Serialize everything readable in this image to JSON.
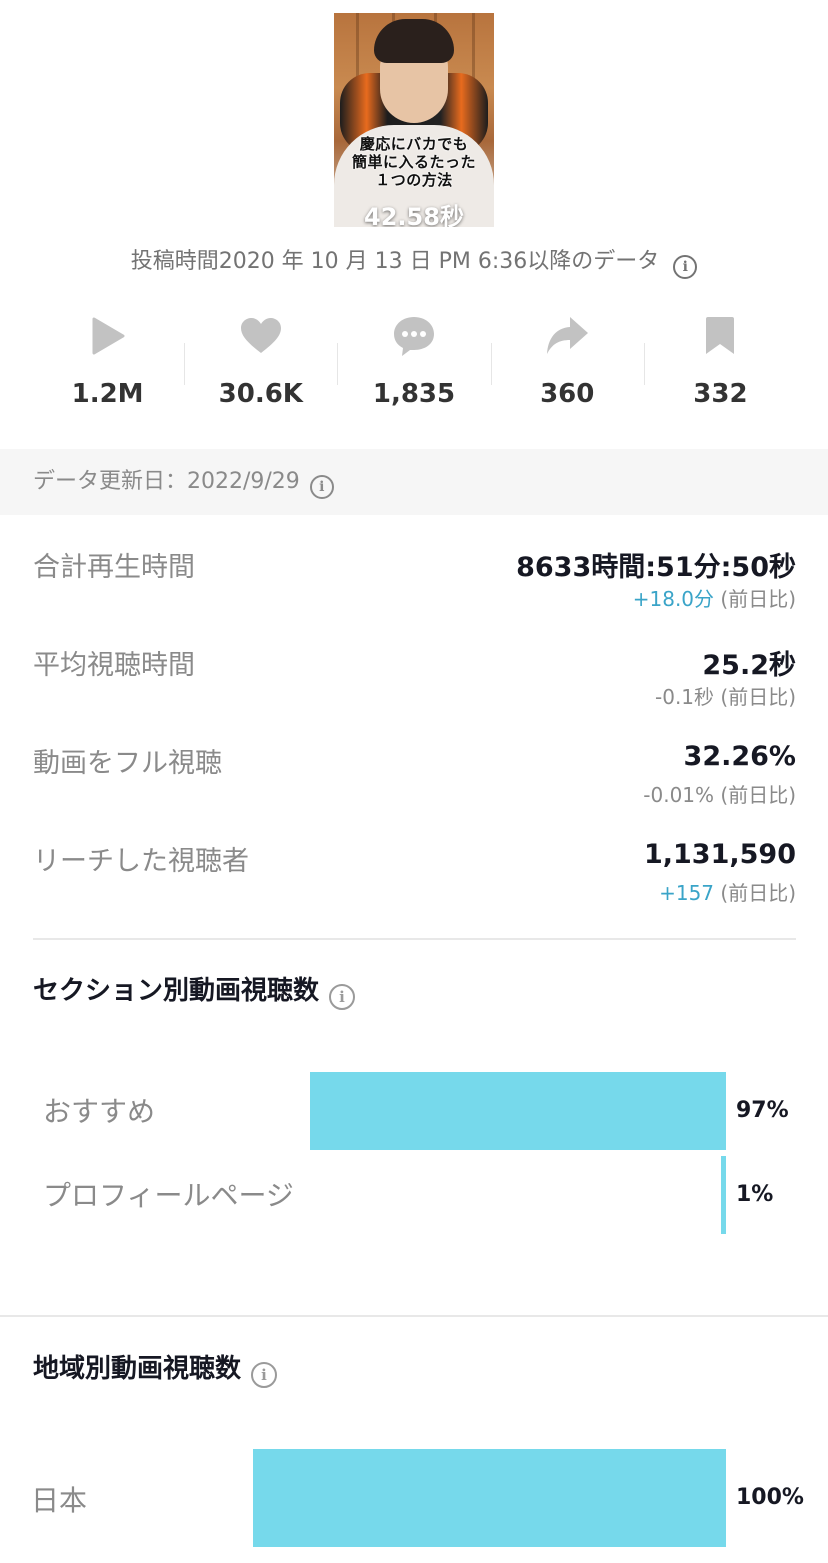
{
  "thumbnail": {
    "caption_lines": [
      "慶応にバカでも",
      "簡単に入るたった",
      "１つの方法"
    ],
    "duration": "42.58秒"
  },
  "posted_note": "投稿時間2020 年 10 月 13 日 PM 6:36以降のデータ",
  "stats": [
    {
      "icon": "play-icon",
      "value": "1.2M"
    },
    {
      "icon": "heart-icon",
      "value": "30.6K"
    },
    {
      "icon": "comment-icon",
      "value": "1,835"
    },
    {
      "icon": "share-icon",
      "value": "360"
    },
    {
      "icon": "bookmark-icon",
      "value": "332"
    }
  ],
  "data_updated": "データ更新日：2022/9/29",
  "metrics": [
    {
      "label": "合計再生時間",
      "value": "8633時間:51分:50秒",
      "delta": "+18.0分",
      "delta_suffix": " (前日比)",
      "delta_positive": true
    },
    {
      "label": "平均視聴時間",
      "value": "25.2秒",
      "delta": "-0.1秒",
      "delta_suffix": " (前日比)",
      "delta_positive": false
    },
    {
      "label": "動画をフル視聴",
      "value": "32.26%",
      "delta": "-0.01%",
      "delta_suffix": " (前日比)",
      "delta_positive": false
    },
    {
      "label": "リーチした視聴者",
      "value": "1,131,590",
      "delta": "+157",
      "delta_suffix": " (前日比)",
      "delta_positive": true
    }
  ],
  "section_views": {
    "title": "セクション別動画視聴数",
    "rows": [
      {
        "label": "おすすめ",
        "percent_text": "97%",
        "value": 97
      },
      {
        "label": "プロフィールページ",
        "percent_text": "1%",
        "value": 1
      }
    ]
  },
  "region_views": {
    "title": "地域別動画視聴数",
    "rows": [
      {
        "label": "日本",
        "percent_text": "100%",
        "value": 100
      }
    ]
  },
  "colors": {
    "bar": "#76d9eb",
    "positive_delta": "#3aa4c8",
    "muted_text": "#8a8a8a"
  }
}
